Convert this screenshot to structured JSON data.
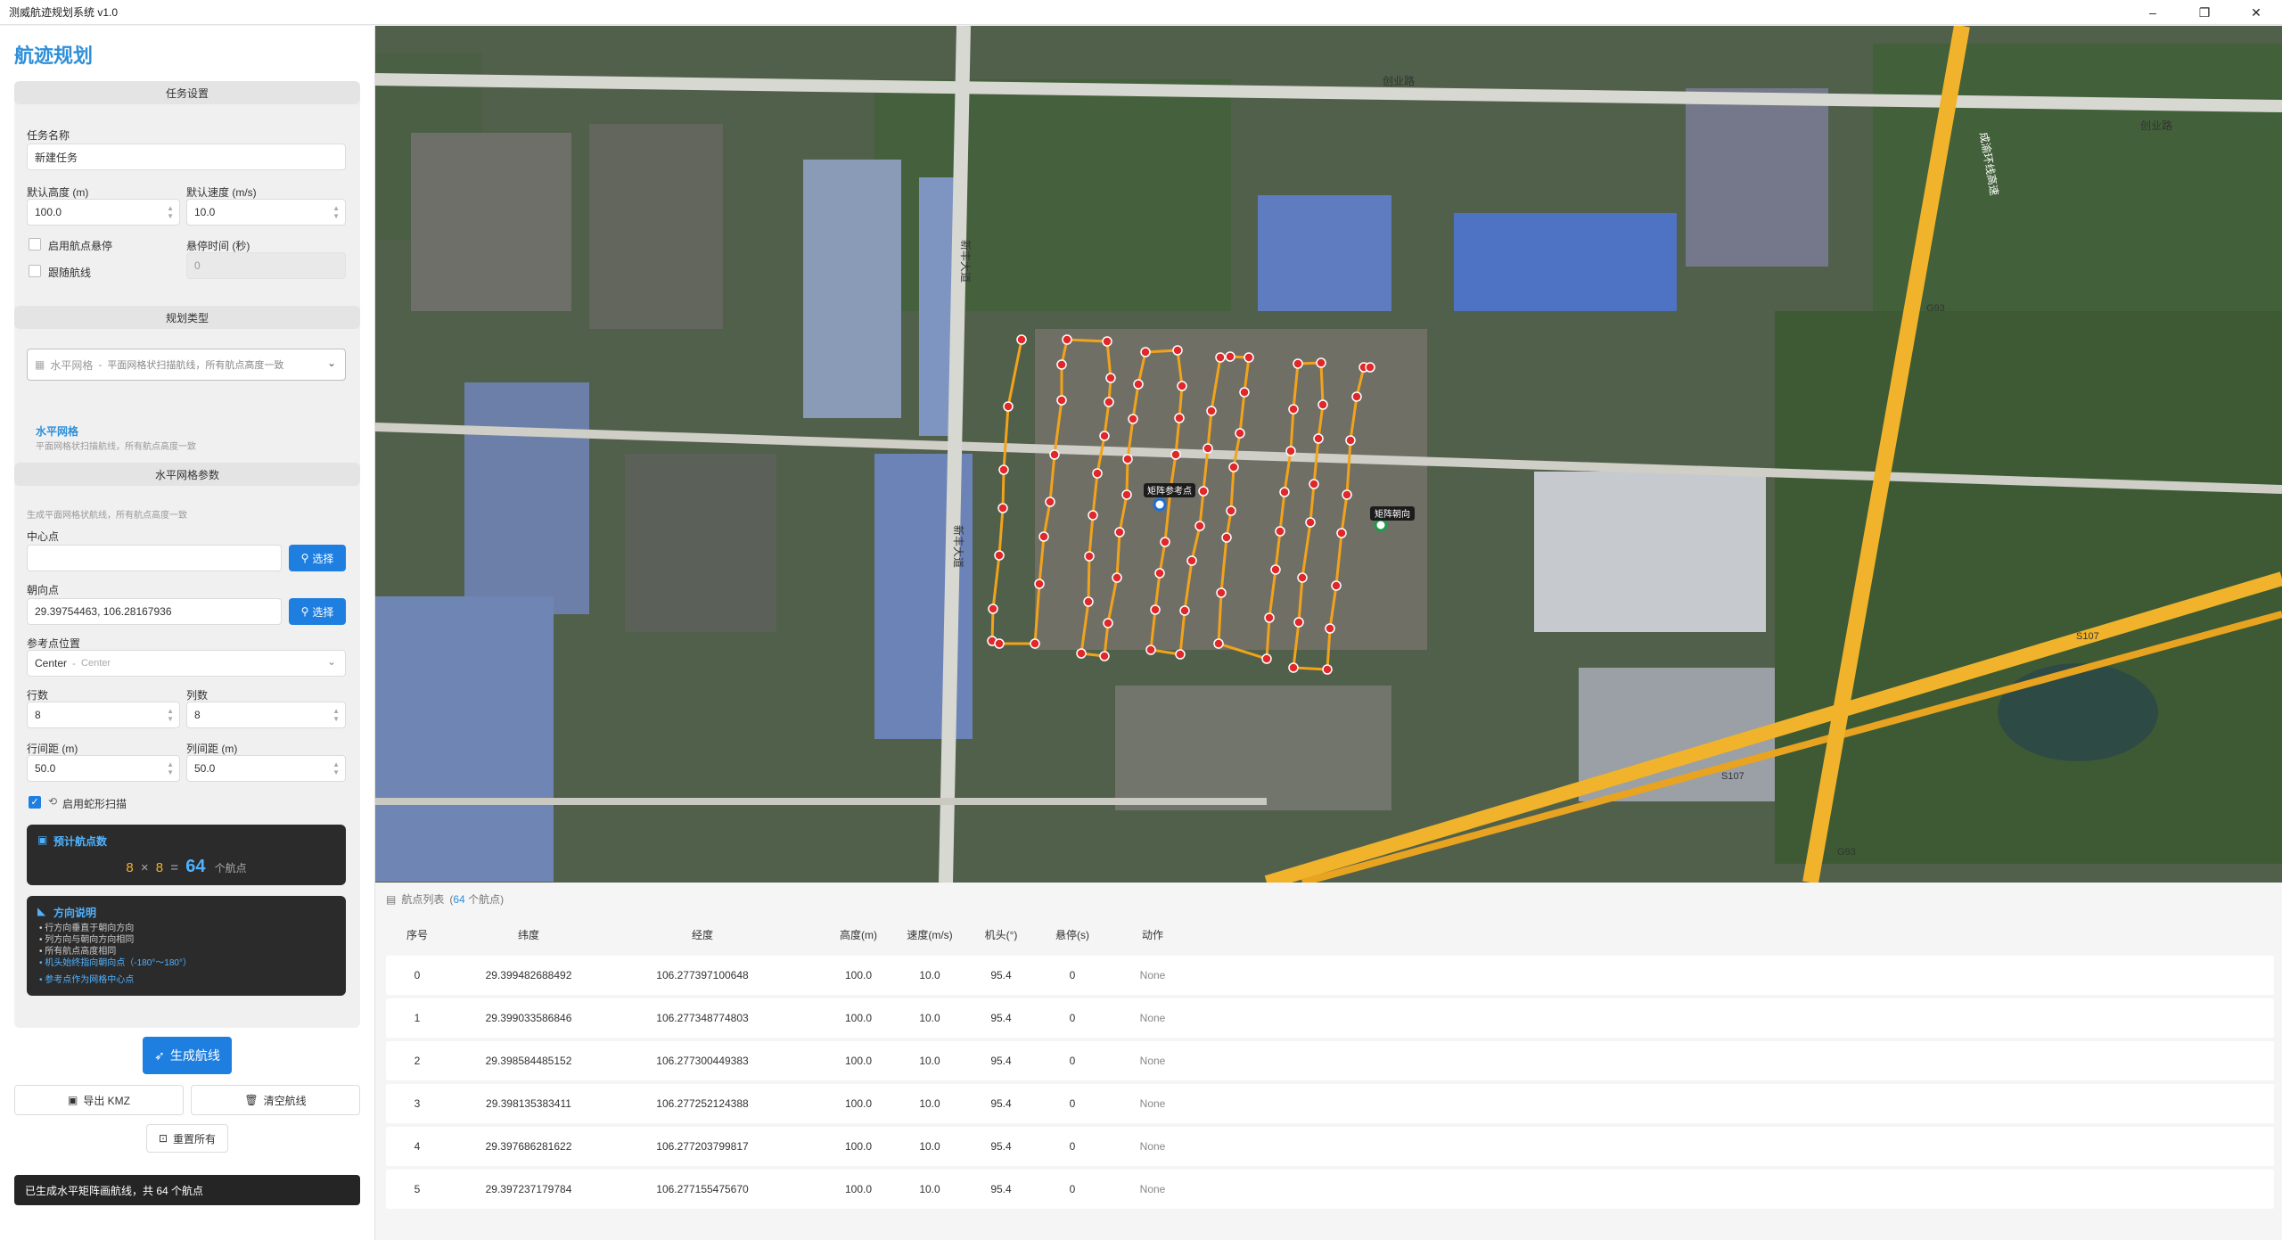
{
  "window": {
    "title": "测威航迹规划系统 v1.0",
    "min": "–",
    "restore": "❐",
    "close": "✕"
  },
  "sidebar": {
    "heading": "航迹规划",
    "task": {
      "header": "任务设置",
      "name_label": "任务名称",
      "name_value": "新建任务",
      "alt_label": "默认高度 (m)",
      "alt_value": "100.0",
      "speed_label": "默认速度 (m/s)",
      "speed_value": "10.0",
      "hover_enable_label": "启用航点悬停",
      "hover_time_label": "悬停时间 (秒)",
      "hover_time_value": "0",
      "follow_label": "跟随航线"
    },
    "plan_type": {
      "header": "规划类型",
      "select_icon": "grid-icon",
      "select_main": "水平网格",
      "select_sep": "-",
      "select_desc": "平面网格状扫描航线，所有航点高度一致",
      "info_title": "水平网格",
      "info_desc": "平面网格状扫描航线，所有航点高度一致"
    },
    "grid": {
      "header": "水平网格参数",
      "intro": "生成平面网格状航线，所有航点高度一致",
      "center_label": "中心点",
      "center_value": "",
      "center_btn": "选择",
      "heading_label": "朝向点",
      "heading_value": "29.39754463, 106.28167936",
      "heading_btn": "选择",
      "ref_label": "参考点位置",
      "ref_value": "Center",
      "ref_sep": "-",
      "ref_desc": "Center",
      "rows_label": "行数",
      "rows_value": "8",
      "cols_label": "列数",
      "cols_value": "8",
      "row_spacing_label": "行间距 (m)",
      "row_spacing_value": "50.0",
      "col_spacing_label": "列间距 (m)",
      "col_spacing_value": "50.0",
      "snake_label": "启用蛇形扫描",
      "snake_checked": true
    },
    "estimate": {
      "title": "预计航点数",
      "rows": "8",
      "times": "×",
      "cols": "8",
      "eq": "=",
      "total": "64",
      "unit": "个航点"
    },
    "direction": {
      "title": "方向说明",
      "lines": [
        "• 行方向垂直于朝向方向",
        "• 列方向与朝向方向相同",
        "• 所有航点高度相同",
        "• 机头始终指向朝向点（-180°～180°）",
        "• 参考点作为网格中心点"
      ]
    },
    "actions": {
      "generate": "生成航线",
      "export": "导出 KMZ",
      "clear": "清空航线",
      "reset": "重置所有"
    },
    "status": "已生成水平矩阵画航线，共 64 个航点"
  },
  "map": {
    "labels": {
      "road_chuangye": "创业路",
      "road_chuangye2": "创业路",
      "road_xinfeng": "新丰大道",
      "road_xinfeng2": "新丰大道",
      "ref_marker": "矩阵参考点",
      "heading_marker": "矩阵朝向",
      "s107": "S107",
      "s107b": "S107",
      "g93": "G93",
      "g93b": "G93",
      "highway": "成渝环线高速"
    },
    "accent_route": "#f2a31b",
    "waypoint_color": "#e0282a"
  },
  "waypoints": {
    "title": "航点列表",
    "count_open": "(",
    "count": "64",
    "count_close": "个航点)",
    "columns": [
      "序号",
      "纬度",
      "经度",
      "高度(m)",
      "速度(m/s)",
      "机头(°)",
      "悬停(s)",
      "动作"
    ],
    "rows": [
      [
        "0",
        "29.399482688492",
        "106.277397100648",
        "100.0",
        "10.0",
        "95.4",
        "0",
        "None"
      ],
      [
        "1",
        "29.399033586846",
        "106.277348774803",
        "100.0",
        "10.0",
        "95.4",
        "0",
        "None"
      ],
      [
        "2",
        "29.398584485152",
        "106.277300449383",
        "100.0",
        "10.0",
        "95.4",
        "0",
        "None"
      ],
      [
        "3",
        "29.398135383411",
        "106.277252124388",
        "100.0",
        "10.0",
        "95.4",
        "0",
        "None"
      ],
      [
        "4",
        "29.397686281622",
        "106.277203799817",
        "100.0",
        "10.0",
        "95.4",
        "0",
        "None"
      ],
      [
        "5",
        "29.397237179784",
        "106.277155475670",
        "100.0",
        "10.0",
        "95.4",
        "0",
        "None"
      ]
    ]
  }
}
